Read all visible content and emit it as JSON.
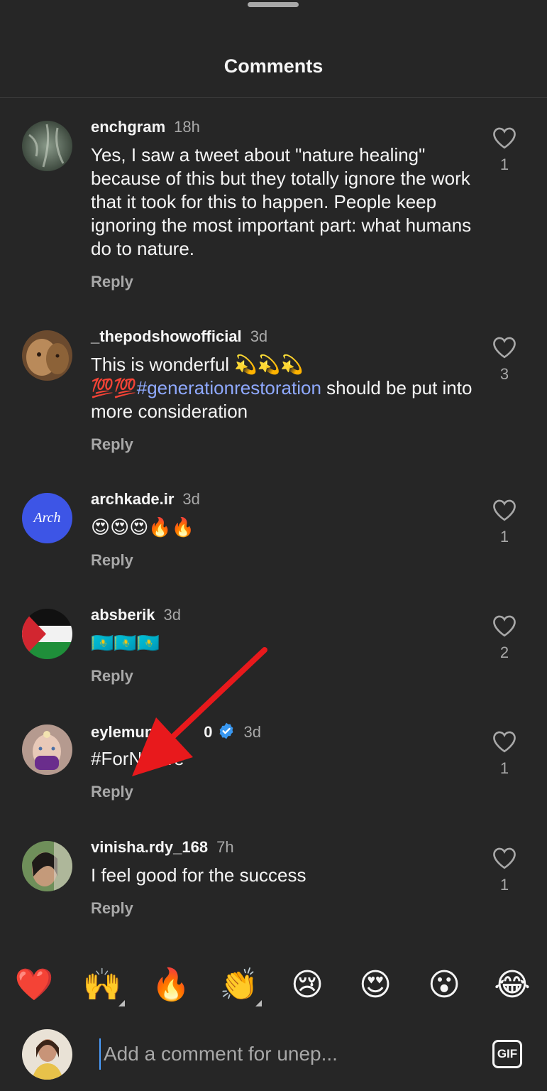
{
  "header": {
    "title": "Comments"
  },
  "comments": [
    {
      "username": "enchgram",
      "time": "18h",
      "text": "Yes, I saw a tweet about \"nature healing\" because of this but they totally ignore the work that it took for this to happen. People keep ignoring the most important part: what humans do to nature.",
      "likes": "1",
      "reply": "Reply"
    },
    {
      "username": "_thepodshowofficial",
      "time": "3d",
      "text_pre": "This is wonderful 💫💫💫 💯💯",
      "hashtag": "#generationrestoration",
      "text_post": "  should be put into more consideration",
      "likes": "3",
      "reply": "Reply"
    },
    {
      "username": "archkade.ir",
      "time": "3d",
      "text": "😍😍😍🔥🔥",
      "likes": "1",
      "reply": "Reply",
      "avatar_text": "Arch"
    },
    {
      "username": "absberik",
      "time": "3d",
      "text": "🇰🇿🇰🇿🇰🇿",
      "likes": "2",
      "reply": "Reply"
    },
    {
      "username": "eylemun",
      "username_suffix": "0",
      "time": "3d",
      "text": "#ForNature",
      "likes": "1",
      "reply": "Reply"
    },
    {
      "username": "vinisha.rdy_168",
      "time": "7h",
      "text": "I feel good for the success",
      "likes": "1",
      "reply": "Reply"
    }
  ],
  "emoji_bar": [
    "❤️",
    "🙌",
    "🔥",
    "👏",
    "😢",
    "😍",
    "😮",
    "😂"
  ],
  "composer": {
    "placeholder": "Add a comment for unep...",
    "gif_label": "GIF"
  },
  "colors": {
    "background": "#262626",
    "text": "#f5f5f5",
    "muted": "#a8a8a8",
    "hashtag": "#8fa9ff",
    "annotation_arrow": "#e8191c",
    "verified": "#3897f0"
  }
}
